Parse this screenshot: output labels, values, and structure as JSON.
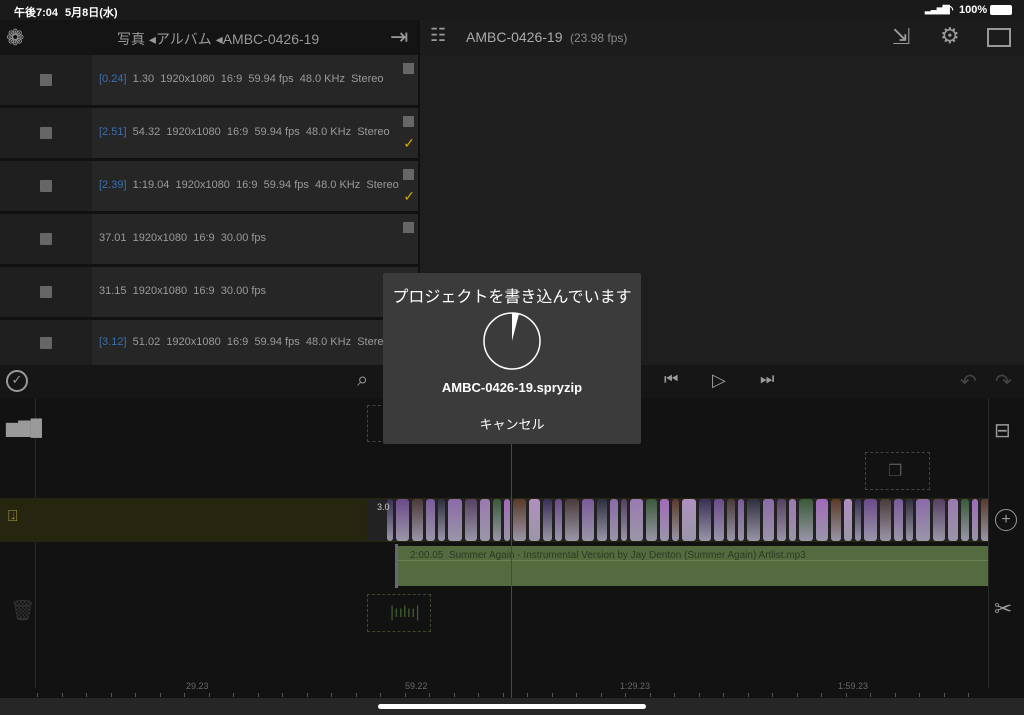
{
  "status_bar": {
    "time": "午後7:04",
    "date": "5月8日(水)",
    "battery": "100%"
  },
  "left_header": {
    "breadcrumb": [
      "写真",
      "アルバム",
      "AMBC-0426-19"
    ]
  },
  "right_header": {
    "project_name": "AMBC-0426-19",
    "fps": "(23.98 fps)"
  },
  "clips": [
    {
      "offset": "[0.24]",
      "duration": "1.30",
      "resolution": "1920x1080",
      "aspect": "16:9",
      "fps": "59.94 fps",
      "audio": "48.0 KHz",
      "channels": "Stereo",
      "checked": false
    },
    {
      "offset": "[2.51]",
      "duration": "54.32",
      "resolution": "1920x1080",
      "aspect": "16:9",
      "fps": "59.94 fps",
      "audio": "48.0 KHz",
      "channels": "Stereo",
      "checked": true
    },
    {
      "offset": "[2.39]",
      "duration": "1:19.04",
      "resolution": "1920x1080",
      "aspect": "16:9",
      "fps": "59.94 fps",
      "audio": "48.0 KHz",
      "channels": "Stereo",
      "checked": true
    },
    {
      "offset": "",
      "duration": "37.01",
      "resolution": "1920x1080",
      "aspect": "16:9",
      "fps": "30.00 fps",
      "audio": "",
      "channels": "",
      "checked": false
    },
    {
      "offset": "",
      "duration": "31.15",
      "resolution": "1920x1080",
      "aspect": "16:9",
      "fps": "30.00 fps",
      "audio": "",
      "channels": "",
      "checked": false
    },
    {
      "offset": "[3.12]",
      "duration": "51.02",
      "resolution": "1920x1080",
      "aspect": "16:9",
      "fps": "59.94 fps",
      "audio": "48.0 KHz",
      "channels": "Stereo",
      "checked": false
    }
  ],
  "timeline": {
    "video_clip_label": "3.0",
    "audio_clip": {
      "duration": "2:00.05",
      "title": "Summer Again - Instrumental Version by Jay Denton (Summer Again) Artlist.mp3"
    },
    "ruler_labels": [
      "29.23",
      "59.22",
      "1:29.23",
      "1:59.23"
    ]
  },
  "dialog": {
    "title": "プロジェクトを書き込んでいます",
    "progress": 0.04,
    "filename": "AMBC-0426-19.spryzip",
    "cancel_label": "キャンセル"
  },
  "colors": {
    "accent_blue": "#3a6fb0",
    "check": "#d4a800",
    "audio_track": "#536b3f"
  }
}
